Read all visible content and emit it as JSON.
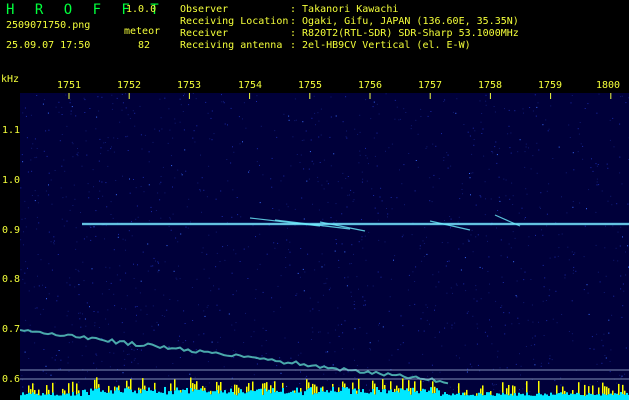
{
  "header": {
    "logo": "H R O F F T",
    "version": "1.0.0",
    "filename": "2509071750.png",
    "mode": "meteor",
    "datetime": "25.09.07 17:50",
    "count": "82",
    "info": [
      {
        "label": "Observer",
        "value": ": Takanori Kawachi"
      },
      {
        "label": "Receiving Location",
        "value": ": Ogaki, Gifu, JAPAN (136.60E, 35.35N)"
      },
      {
        "label": "Receiver",
        "value": ": R820T2(RTL-SDR) SDR-Sharp 53.1000MHz"
      },
      {
        "label": "Receiving antenna",
        "value": ": 2el-HB9CV Vertical (el. E-W)"
      }
    ]
  },
  "axis": {
    "y_unit": "kHz",
    "y_ticks": [
      "1.1",
      "1.0",
      "0.9",
      "0.8",
      "0.7",
      "0.6"
    ],
    "x_ticks": [
      "1751",
      "1752",
      "1753",
      "1754",
      "1755",
      "1756",
      "1757",
      "1758",
      "1759",
      "1800"
    ]
  },
  "colors": {
    "text": "#f4ff3a",
    "logo": "#00ff3c",
    "background": "#00003a",
    "carrier": "#9ff7ff",
    "level_bars": "#00e8ff",
    "level_peaks": "#ffff00"
  }
}
